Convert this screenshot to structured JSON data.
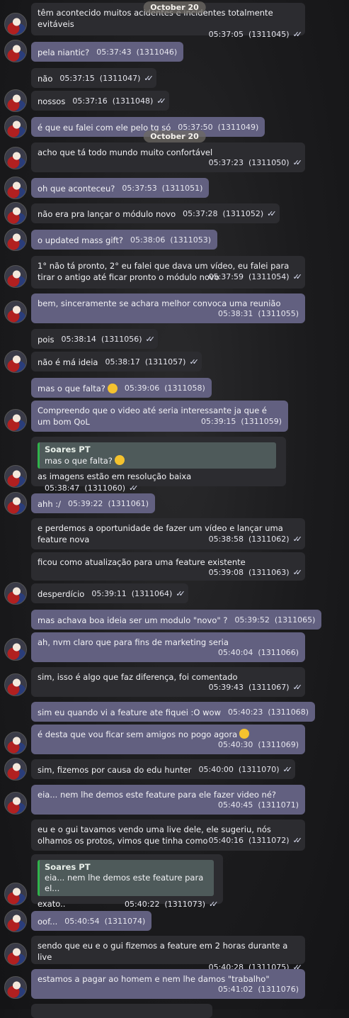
{
  "date_label": "October 20",
  "messages": [
    {
      "dir": "in",
      "text": "têm acontecido muitos acidentes e incidentes totalmente evitáveis",
      "time": "05:37:05",
      "id": "(1311045)",
      "ticks": true
    },
    {
      "dir": "out",
      "text": "pela niantic?",
      "time": "05:37:43",
      "id": "(1311046)",
      "ticks": false
    },
    {
      "dir": "in",
      "text": "não",
      "time": "05:37:15",
      "id": "(1311047)",
      "ticks": true
    },
    {
      "dir": "in",
      "text": "nossos",
      "time": "05:37:16",
      "id": "(1311048)",
      "ticks": true
    },
    {
      "dir": "out",
      "text": "é que eu falei com ele pelo tg só",
      "time": "05:37:50",
      "id": "(1311049)",
      "ticks": false
    },
    {
      "dir": "in",
      "text": "acho que tá todo mundo muito confortável",
      "time": "05:37:23",
      "id": "(1311050)",
      "ticks": true
    },
    {
      "dir": "out",
      "text": "oh que aconteceu?",
      "time": "05:37:53",
      "id": "(1311051)",
      "ticks": false
    },
    {
      "dir": "in",
      "text": "não era pra lançar o módulo novo",
      "time": "05:37:28",
      "id": "(1311052)",
      "ticks": true
    },
    {
      "dir": "out",
      "text": "o updated mass gift?",
      "time": "05:38:06",
      "id": "(1311053)",
      "ticks": false
    },
    {
      "dir": "in",
      "text": "1° não tá pronto, 2° eu falei que dava um vídeo, eu falei para tirar o antigo até ficar pronto o módulo novo",
      "time": "05:37:59",
      "id": "(1311054)",
      "ticks": true
    },
    {
      "dir": "out",
      "text": "bem, sinceramente se achara melhor convoca uma reunião",
      "time": "05:38:31",
      "id": "(1311055)",
      "ticks": false
    },
    {
      "dir": "in",
      "text": "pois",
      "time": "05:38:14",
      "id": "(1311056)",
      "ticks": true
    },
    {
      "dir": "in",
      "text": "não é má ideia",
      "time": "05:38:17",
      "id": "(1311057)",
      "ticks": true
    },
    {
      "dir": "out",
      "text": "mas o que falta?",
      "time": "05:39:06",
      "id": "(1311058)",
      "ticks": false,
      "emoji": "thinking-face"
    },
    {
      "dir": "out",
      "text": "Compreendo que o video até seria interessante ja que é um bom QoL",
      "time": "05:39:15",
      "id": "(1311059)",
      "ticks": false
    },
    {
      "dir": "in",
      "reply_name": "Soares PT",
      "reply_text": "mas o que falta?",
      "reply_emoji": "thinking-face",
      "text": "as imagens estão em resolução baixa",
      "time": "05:38:47",
      "id": "(1311060)",
      "ticks": true
    },
    {
      "dir": "out",
      "text": "ahh :/",
      "time": "05:39:22",
      "id": "(1311061)",
      "ticks": false
    },
    {
      "dir": "in",
      "text": "e perdemos a oportunidade de fazer um vídeo e lançar uma feature nova",
      "time": "05:38:58",
      "id": "(1311062)",
      "ticks": true
    },
    {
      "dir": "in",
      "text": "ficou como atualização para uma feature existente",
      "time": "05:39:08",
      "id": "(1311063)",
      "ticks": true
    },
    {
      "dir": "in",
      "text": "desperdício",
      "time": "05:39:11",
      "id": "(1311064)",
      "ticks": true
    },
    {
      "dir": "out",
      "text": "mas achava boa ideia ser um modulo \"novo\" ?",
      "time": "05:39:52",
      "id": "(1311065)",
      "ticks": false
    },
    {
      "dir": "out",
      "text": "ah, nvm claro que para fins de marketing seria",
      "time": "05:40:04",
      "id": "(1311066)",
      "ticks": false
    },
    {
      "dir": "in",
      "text": "sim, isso é algo que faz diferença, foi comentado",
      "time": "05:39:43",
      "id": "(1311067)",
      "ticks": true
    },
    {
      "dir": "out",
      "text": "sim eu quando vi a feature ate fiquei :O wow",
      "time": "05:40:23",
      "id": "(1311068)",
      "ticks": false
    },
    {
      "dir": "out",
      "text": "é desta que vou ficar sem amigos no pogo agora",
      "time": "05:40:30",
      "id": "(1311069)",
      "ticks": false,
      "emoji": "joy-face"
    },
    {
      "dir": "in",
      "text": "sim, fizemos por causa do edu hunter",
      "time": "05:40:00",
      "id": "(1311070)",
      "ticks": true
    },
    {
      "dir": "out",
      "text": "eia... nem lhe demos este feature para ele fazer video né?",
      "time": "05:40:45",
      "id": "(1311071)",
      "ticks": false
    },
    {
      "dir": "in",
      "text": "eu e o gui tavamos vendo uma live dele, ele sugeriu, nós olhamos os protos, vimos que tinha como",
      "time": "05:40:16",
      "id": "(1311072)",
      "ticks": true
    },
    {
      "dir": "in",
      "reply_name": "Soares PT",
      "reply_text": "eia... nem lhe demos este feature para el...",
      "text": "exato..",
      "time": "05:40:22",
      "id": "(1311073)",
      "ticks": true
    },
    {
      "dir": "out",
      "text": "oof...",
      "time": "05:40:54",
      "id": "(1311074)",
      "ticks": false
    },
    {
      "dir": "in",
      "text": "sendo que eu e o gui fizemos a feature em 2 horas durante a live",
      "time": "05:40:28",
      "id": "(1311075)",
      "ticks": true
    },
    {
      "dir": "out",
      "text": "estamos a pagar ao homem e nem lhe damos \"trabalho\"",
      "time": "05:41:02",
      "id": "(1311076)",
      "ticks": false
    }
  ]
}
